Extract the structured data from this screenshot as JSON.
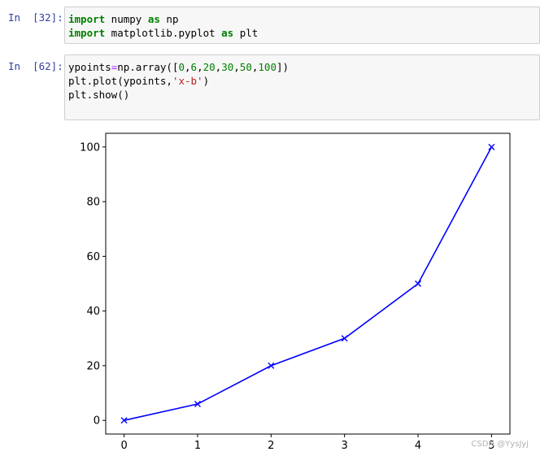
{
  "cells": [
    {
      "prompt": "In  [32]:",
      "lines": [
        [
          {
            "t": "import",
            "c": "kw"
          },
          {
            "t": " numpy ",
            "c": ""
          },
          {
            "t": "as",
            "c": "kw"
          },
          {
            "t": " np",
            "c": ""
          }
        ],
        [
          {
            "t": "import",
            "c": "kw"
          },
          {
            "t": " matplotlib.pyplot ",
            "c": ""
          },
          {
            "t": "as",
            "c": "kw"
          },
          {
            "t": " plt",
            "c": ""
          }
        ]
      ]
    },
    {
      "prompt": "In  [62]:",
      "lines": [
        [
          {
            "t": "ypoints",
            "c": ""
          },
          {
            "t": "=",
            "c": "op"
          },
          {
            "t": "np.array([",
            "c": ""
          },
          {
            "t": "0",
            "c": "num"
          },
          {
            "t": ",",
            "c": ""
          },
          {
            "t": "6",
            "c": "num"
          },
          {
            "t": ",",
            "c": ""
          },
          {
            "t": "20",
            "c": "num"
          },
          {
            "t": ",",
            "c": ""
          },
          {
            "t": "30",
            "c": "num"
          },
          {
            "t": ",",
            "c": ""
          },
          {
            "t": "50",
            "c": "num"
          },
          {
            "t": ",",
            "c": ""
          },
          {
            "t": "100",
            "c": "num"
          },
          {
            "t": "])",
            "c": ""
          }
        ],
        [
          {
            "t": "plt.plot(ypoints,",
            "c": ""
          },
          {
            "t": "'x-b'",
            "c": "str"
          },
          {
            "t": ")",
            "c": ""
          }
        ],
        [
          {
            "t": "plt.show()",
            "c": ""
          }
        ]
      ]
    }
  ],
  "chart_data": {
    "type": "line",
    "x": [
      0,
      1,
      2,
      3,
      4,
      5
    ],
    "series": [
      {
        "values": [
          0,
          6,
          20,
          30,
          50,
          100
        ],
        "color": "#0000ff",
        "marker": "x"
      }
    ],
    "xticks": [
      "0",
      "1",
      "2",
      "3",
      "4",
      "5"
    ],
    "yticks": [
      "0",
      "20",
      "40",
      "60",
      "80",
      "100"
    ],
    "xlim": [
      -0.25,
      5.25
    ],
    "ylim": [
      -5,
      105
    ],
    "grid": false
  },
  "watermark": "CSDN @YysJyj"
}
